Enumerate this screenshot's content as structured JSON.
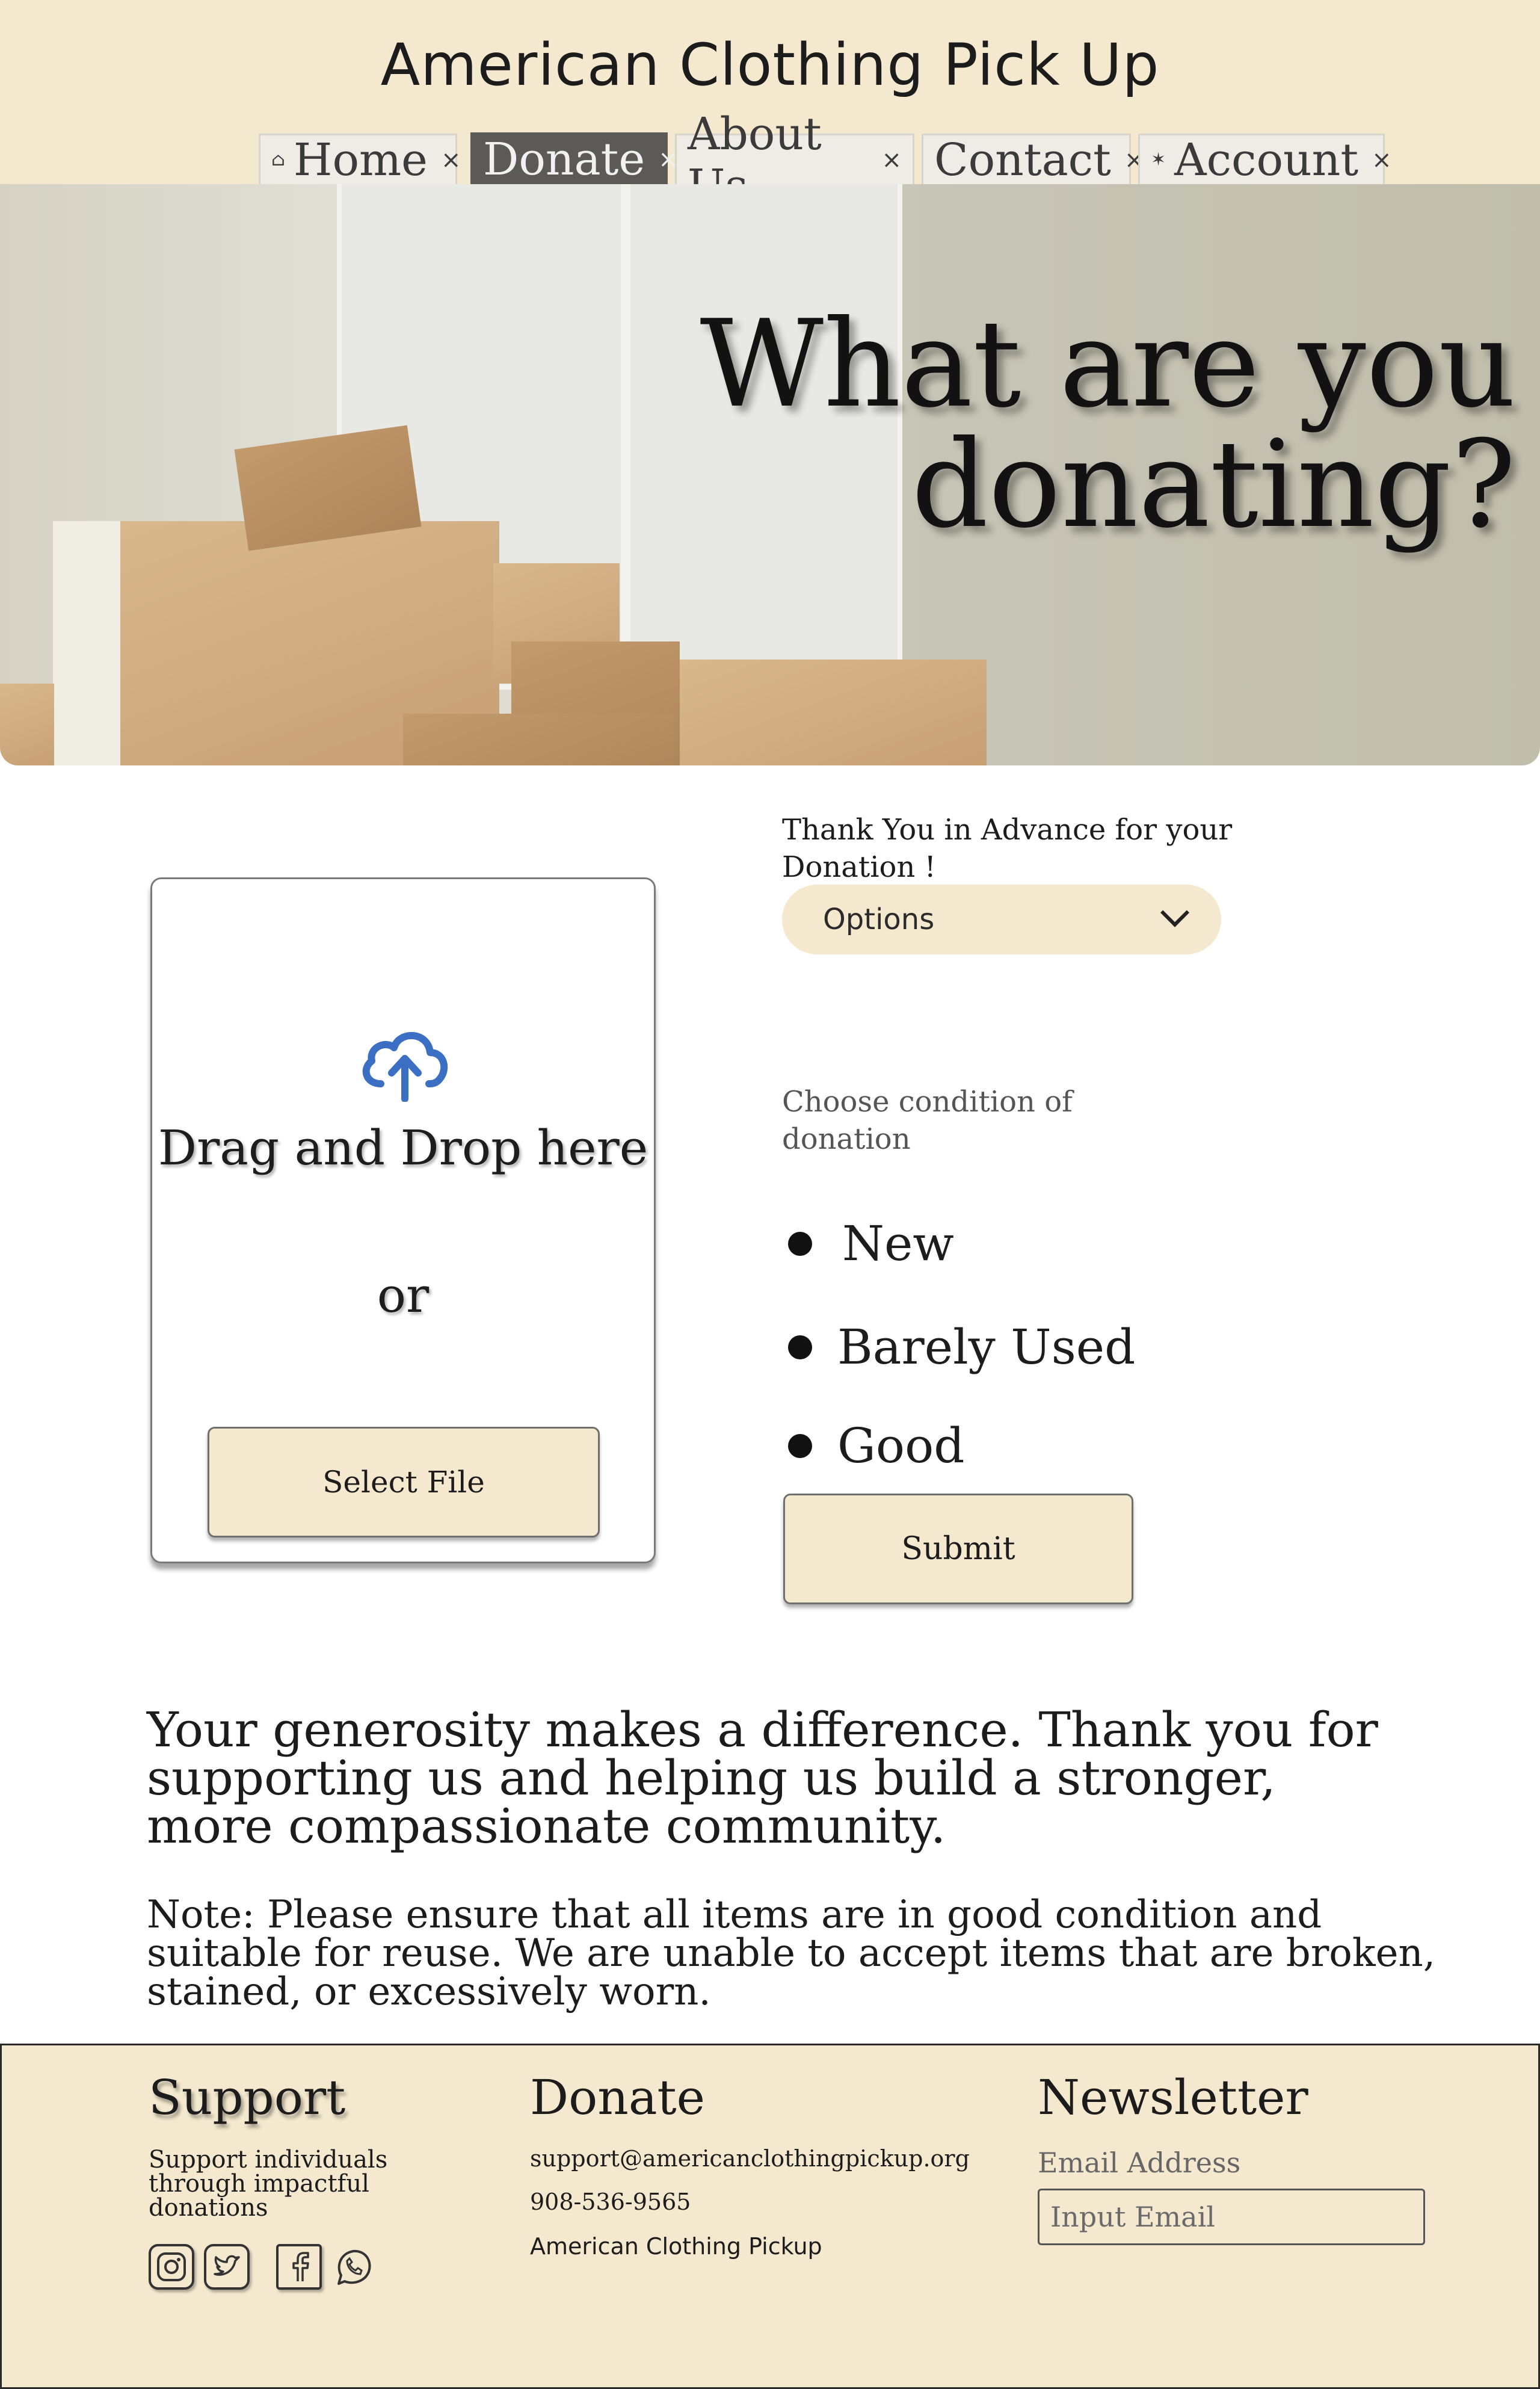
{
  "header": {
    "site_title": "American Clothing Pick Up",
    "nav": [
      {
        "label": "Home",
        "icon": "home-icon",
        "active": false
      },
      {
        "label": "Donate",
        "icon": "",
        "active": true
      },
      {
        "label": "About Us",
        "icon": "",
        "active": false
      },
      {
        "label": "Contact",
        "icon": "",
        "active": false
      },
      {
        "label": "Account",
        "icon": "star-icon",
        "active": false
      }
    ],
    "close_glyph": "×"
  },
  "hero": {
    "title_line1": "What are you",
    "title_line2": "donating?"
  },
  "upload": {
    "drag_text": "Drag and Drop here",
    "or_text": "or",
    "select_label": "Select File"
  },
  "form": {
    "thanks_text": "Thank You in Advance for your Donation !",
    "dropdown_value": "Options",
    "condition_label": "Choose  condition of donation",
    "conditions": [
      "New",
      "Barely Used",
      "Good"
    ],
    "submit_label": "Submit"
  },
  "message": {
    "generosity": "Your generosity makes a difference. Thank you for supporting us and helping us build a stronger, more compassionate community.",
    "note": "Note: Please ensure that all items are in good condition and suitable for reuse. We are unable to accept items that are broken, stained, or excessively worn."
  },
  "footer": {
    "support_heading": "Support",
    "support_text": "Support individuals through impactful donations",
    "donate_heading": "Donate",
    "email": "support@americanclothingpickup.org",
    "phone": "908-536-9565",
    "brand": "American Clothing Pickup",
    "newsletter_heading": "Newsletter",
    "email_label": "Email Address",
    "email_placeholder": "Input Email",
    "social": [
      "instagram-icon",
      "twitter-icon",
      "facebook-icon",
      "whatsapp-icon"
    ]
  },
  "colors": {
    "cream": "#f4e9cf",
    "nav_active": "#5b5a56",
    "upload_blue": "#3a6fc4"
  }
}
